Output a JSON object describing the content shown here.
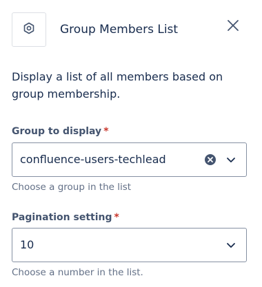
{
  "header": {
    "icon": "hexagon-icon",
    "title": "Group Members List",
    "close_icon": "close-icon"
  },
  "description": "Display a list of all members based on group membership.",
  "fields": {
    "group": {
      "label": "Group to display",
      "required_mark": "*",
      "value": "confluence-users-techlead",
      "helper": "Choose a group in the list"
    },
    "pagination": {
      "label": "Pagination setting",
      "required_mark": "*",
      "value": "10",
      "helper": "Choose a number in the list."
    }
  },
  "colors": {
    "text": "#172B4D",
    "label": "#44546F",
    "helper": "#626F86",
    "required": "#C9372C",
    "border": "#8590A2"
  }
}
